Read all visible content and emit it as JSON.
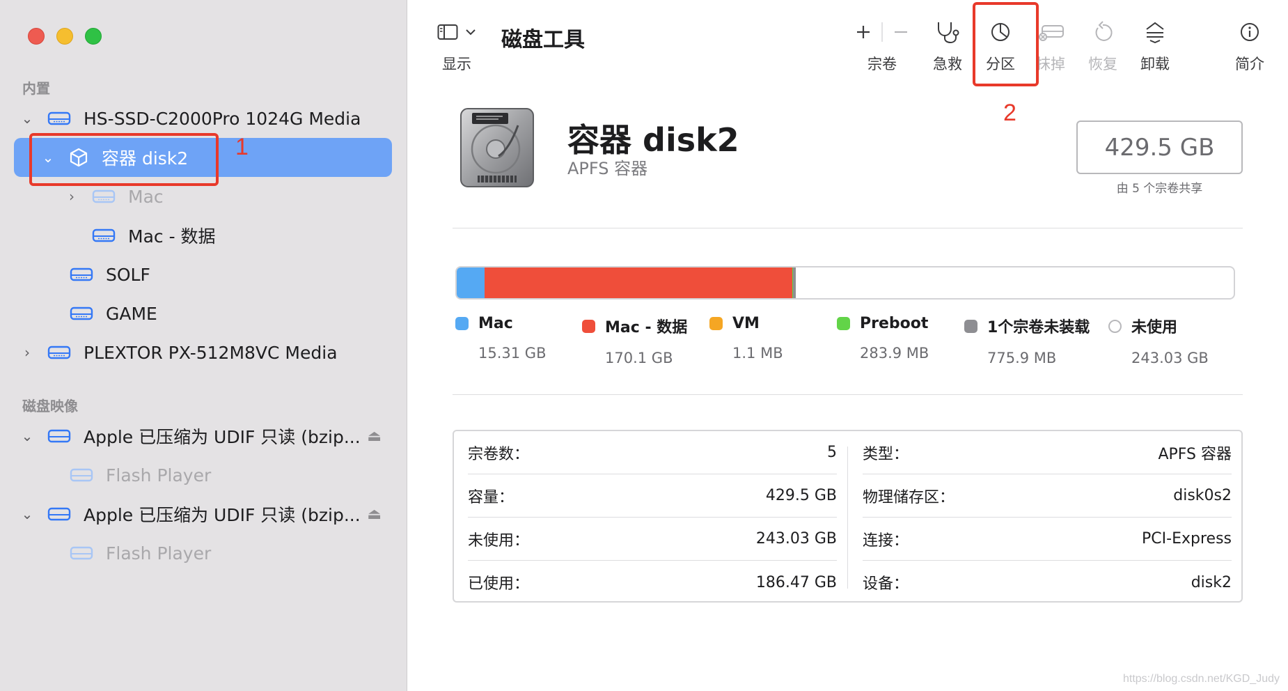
{
  "app": {
    "title": "磁盘工具"
  },
  "toolbar": {
    "view_label": "显示",
    "volume_label": "宗卷",
    "firstaid_label": "急救",
    "partition_label": "分区",
    "erase_label": "抹掉",
    "restore_label": "恢复",
    "unmount_label": "卸载",
    "info_label": "简介"
  },
  "sidebar": {
    "section_internal": "内置",
    "section_images": "磁盘映像",
    "items": [
      {
        "label": "HS-SSD-C2000Pro 1024G Media"
      },
      {
        "label": "容器 disk2"
      },
      {
        "label": "Mac"
      },
      {
        "label": "Mac - 数据"
      },
      {
        "label": "SOLF"
      },
      {
        "label": "GAME"
      },
      {
        "label": "PLEXTOR PX-512M8VC Media"
      },
      {
        "label": "Apple 已压缩为 UDIF 只读 (bzip..."
      },
      {
        "label": "Flash Player"
      },
      {
        "label": "Apple 已压缩为 UDIF 只读 (bzip..."
      },
      {
        "label": "Flash Player"
      }
    ]
  },
  "header": {
    "title": "容器 disk2",
    "subtitle": "APFS 容器",
    "size": "429.5 GB",
    "size_caption": "由 5 个宗卷共享"
  },
  "usage": {
    "total_gb": 429.5,
    "segments": [
      {
        "name": "Mac",
        "value": "15.31 GB",
        "gb": 15.31,
        "color": "#55a9f3"
      },
      {
        "name": "Mac - 数据",
        "value": "170.1 GB",
        "gb": 170.1,
        "color": "#ef4e3a"
      },
      {
        "name": "VM",
        "value": "1.1 MB",
        "gb": 0.0011,
        "color": "#f5a623"
      },
      {
        "name": "Preboot",
        "value": "283.9 MB",
        "gb": 0.2839,
        "color": "#62d448"
      },
      {
        "name": "1个宗卷未装载",
        "value": "775.9 MB",
        "gb": 0.7759,
        "color": "#8e8e92"
      },
      {
        "name": "未使用",
        "value": "243.03 GB",
        "gb": 243.03,
        "color": "#ffffff"
      }
    ]
  },
  "info": {
    "left": [
      {
        "label": "宗卷数：",
        "value": "5"
      },
      {
        "label": "容量：",
        "value": "429.5 GB"
      },
      {
        "label": "未使用：",
        "value": "243.03 GB"
      },
      {
        "label": "已使用：",
        "value": "186.47 GB"
      }
    ],
    "right": [
      {
        "label": "类型：",
        "value": "APFS 容器"
      },
      {
        "label": "物理储存区：",
        "value": "disk0s2"
      },
      {
        "label": "连接：",
        "value": "PCI-Express"
      },
      {
        "label": "设备：",
        "value": "disk2"
      }
    ]
  },
  "annotations": {
    "one": "1",
    "two": "2"
  },
  "watermark": "https://blog.csdn.net/KGD_Judy"
}
